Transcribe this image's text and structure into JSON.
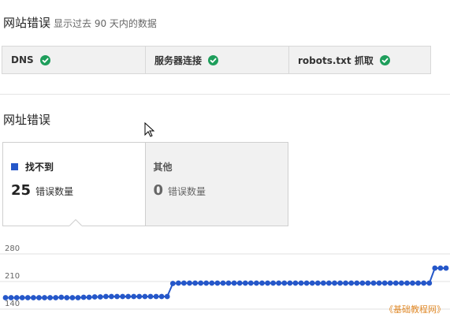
{
  "header": {
    "title": "网站错误",
    "subtitle": "显示过去 90 天内的数据"
  },
  "status_items": [
    {
      "label": "DNS",
      "status": "ok"
    },
    {
      "label": "服务器连接",
      "status": "ok"
    },
    {
      "label": "robots.txt 抓取",
      "status": "ok"
    }
  ],
  "url_errors": {
    "title": "网址错误",
    "cards": [
      {
        "label": "找不到",
        "count": "25",
        "unit": "错误数量",
        "selected": true,
        "color": "#2557c9"
      },
      {
        "label": "其他",
        "count": "0",
        "unit": "错误数量",
        "selected": false
      }
    ]
  },
  "colors": {
    "accent": "#2557c9",
    "ok_green": "#1e9e5b"
  },
  "chart_data": {
    "type": "line",
    "y_ticks": [
      "280",
      "210",
      "140"
    ],
    "ylim": [
      140,
      280
    ],
    "series": [
      {
        "values": [
          169,
          169,
          169,
          169,
          169,
          169,
          169,
          169,
          169,
          169,
          170,
          169,
          169,
          169,
          170,
          170,
          171,
          171,
          172,
          172,
          172,
          172,
          172,
          172,
          172,
          172,
          172,
          172,
          172,
          172,
          205,
          206,
          206,
          206,
          206,
          206,
          206,
          206,
          206,
          206,
          206,
          206,
          206,
          206,
          206,
          206,
          206,
          206,
          206,
          206,
          206,
          206,
          206,
          206,
          206,
          206,
          206,
          206,
          206,
          206,
          206,
          206,
          206,
          206,
          206,
          206,
          206,
          206,
          206,
          206,
          206,
          206,
          206,
          206,
          206,
          206,
          206,
          244,
          244,
          244
        ]
      }
    ]
  },
  "watermark": "《基础教程网》"
}
